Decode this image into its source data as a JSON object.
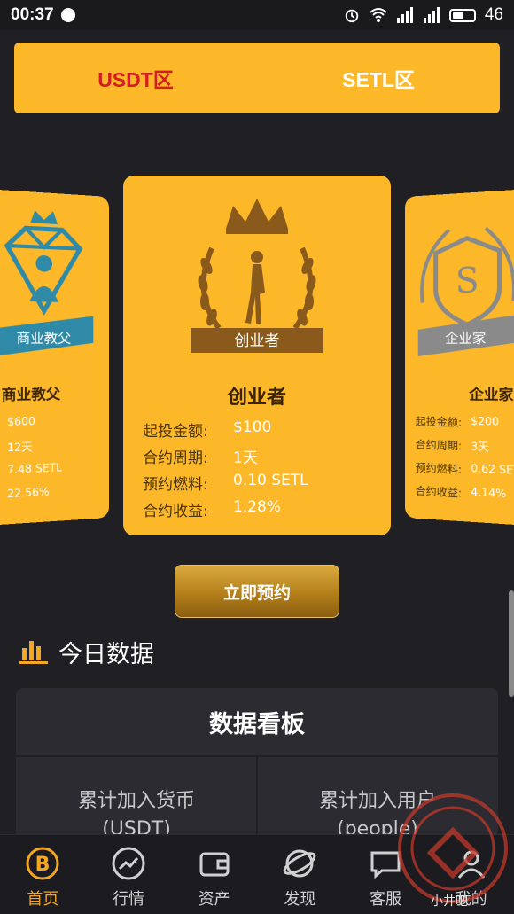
{
  "status_bar": {
    "time": "00:37",
    "battery": "46"
  },
  "zone_tabs": [
    {
      "label": "USDT区"
    },
    {
      "label": "SETL区"
    }
  ],
  "cards": {
    "center": {
      "badge": "创业者",
      "title": "创业者",
      "rows": [
        {
          "label": "起投金额:",
          "value": "$100"
        },
        {
          "label": "合约周期:",
          "value": "1天"
        },
        {
          "label": "预约燃料:",
          "value": "0.10 SETL"
        },
        {
          "label": "合约收益:",
          "value": "1.28%"
        }
      ]
    },
    "left": {
      "badge": "商业教父",
      "title": "商业教父",
      "rows": [
        {
          "label": ":",
          "value": "$600"
        },
        {
          "label": ":",
          "value": "12天"
        },
        {
          "label": ":",
          "value": "7.48 SETL"
        },
        {
          "label": ":",
          "value": "22.56%"
        }
      ]
    },
    "right": {
      "badge": "企业家",
      "title": "企业家",
      "rows": [
        {
          "label": "起投金额:",
          "value": "$200"
        },
        {
          "label": "合约周期:",
          "value": "3天"
        },
        {
          "label": "预约燃料:",
          "value": "0.62 SETL"
        },
        {
          "label": "合约收益:",
          "value": "4.14%"
        }
      ]
    }
  },
  "reserve_button": "立即预约",
  "today": {
    "heading": "今日数据",
    "panel_title": "数据看板",
    "cells": [
      {
        "line1": "累计加入货币",
        "line2": "(USDT)"
      },
      {
        "line1": "累计加入用户",
        "line2": "(people)"
      }
    ]
  },
  "nav": [
    {
      "label": "首页",
      "icon": "bitcoin-icon",
      "active": true
    },
    {
      "label": "行情",
      "icon": "trend-icon",
      "active": false
    },
    {
      "label": "资产",
      "icon": "wallet-icon",
      "active": false
    },
    {
      "label": "发现",
      "icon": "planet-icon",
      "active": false
    },
    {
      "label": "客服",
      "icon": "chat-icon",
      "active": false
    },
    {
      "label": "我的",
      "icon": "user-icon",
      "active": false
    }
  ],
  "watermark_text": "小井吧",
  "colors": {
    "accent": "#fdb82a",
    "active_tab": "#d21f1f",
    "nav_active": "#f5a623",
    "background": "#1f1f24"
  }
}
